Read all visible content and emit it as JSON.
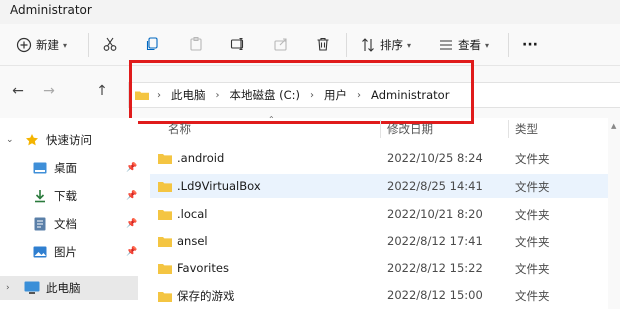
{
  "window": {
    "title": "Administrator"
  },
  "toolbar": {
    "new_label": "新建",
    "sort_label": "排序",
    "view_label": "查看",
    "more_label": "···"
  },
  "address": {
    "crumbs": [
      "此电脑",
      "本地磁盘 (C:)",
      "用户",
      "Administrator"
    ],
    "highlight_color": "#e01b1b"
  },
  "sidebar": {
    "items": [
      {
        "label": "快速访问",
        "icon": "star-icon",
        "pinned": false
      },
      {
        "label": "桌面",
        "icon": "desktop-icon",
        "pinned": true
      },
      {
        "label": "下载",
        "icon": "download-icon",
        "pinned": true
      },
      {
        "label": "文档",
        "icon": "document-icon",
        "pinned": true
      },
      {
        "label": "图片",
        "icon": "picture-icon",
        "pinned": true
      },
      {
        "label": "此电脑",
        "icon": "computer-icon",
        "pinned": false
      }
    ]
  },
  "columns": {
    "name": "名称",
    "date": "修改日期",
    "type": "类型"
  },
  "files": [
    {
      "name": ".android",
      "date": "2022/10/25 8:24",
      "type": "文件夹",
      "selected": false
    },
    {
      "name": ".Ld9VirtualBox",
      "date": "2022/8/25 14:41",
      "type": "文件夹",
      "selected": true
    },
    {
      "name": ".local",
      "date": "2022/10/21 8:20",
      "type": "文件夹",
      "selected": false
    },
    {
      "name": "ansel",
      "date": "2022/8/12 17:41",
      "type": "文件夹",
      "selected": false
    },
    {
      "name": "Favorites",
      "date": "2022/8/12 15:22",
      "type": "文件夹",
      "selected": false
    },
    {
      "name": "保存的游戏",
      "date": "2022/8/12 15:00",
      "type": "文件夹",
      "selected": false
    }
  ],
  "colors": {
    "folder": "#f4c542",
    "selection": "#eaf3fd",
    "accent": "#0067c0"
  }
}
